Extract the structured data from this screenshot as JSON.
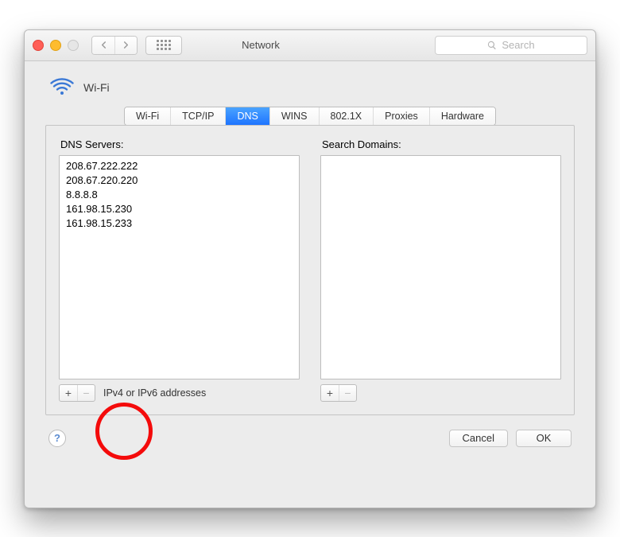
{
  "window": {
    "title": "Network",
    "search_placeholder": "Search"
  },
  "interface": {
    "name": "Wi-Fi"
  },
  "tabs": [
    {
      "label": "Wi-Fi",
      "active": false
    },
    {
      "label": "TCP/IP",
      "active": false
    },
    {
      "label": "DNS",
      "active": true
    },
    {
      "label": "WINS",
      "active": false
    },
    {
      "label": "802.1X",
      "active": false
    },
    {
      "label": "Proxies",
      "active": false
    },
    {
      "label": "Hardware",
      "active": false
    }
  ],
  "dns": {
    "label": "DNS Servers:",
    "servers": [
      "208.67.222.222",
      "208.67.220.220",
      "8.8.8.8",
      "161.98.15.230",
      "161.98.15.233"
    ],
    "hint": "IPv4 or IPv6 addresses"
  },
  "search_domains": {
    "label": "Search Domains:",
    "items": []
  },
  "buttons": {
    "cancel": "Cancel",
    "ok": "OK"
  }
}
